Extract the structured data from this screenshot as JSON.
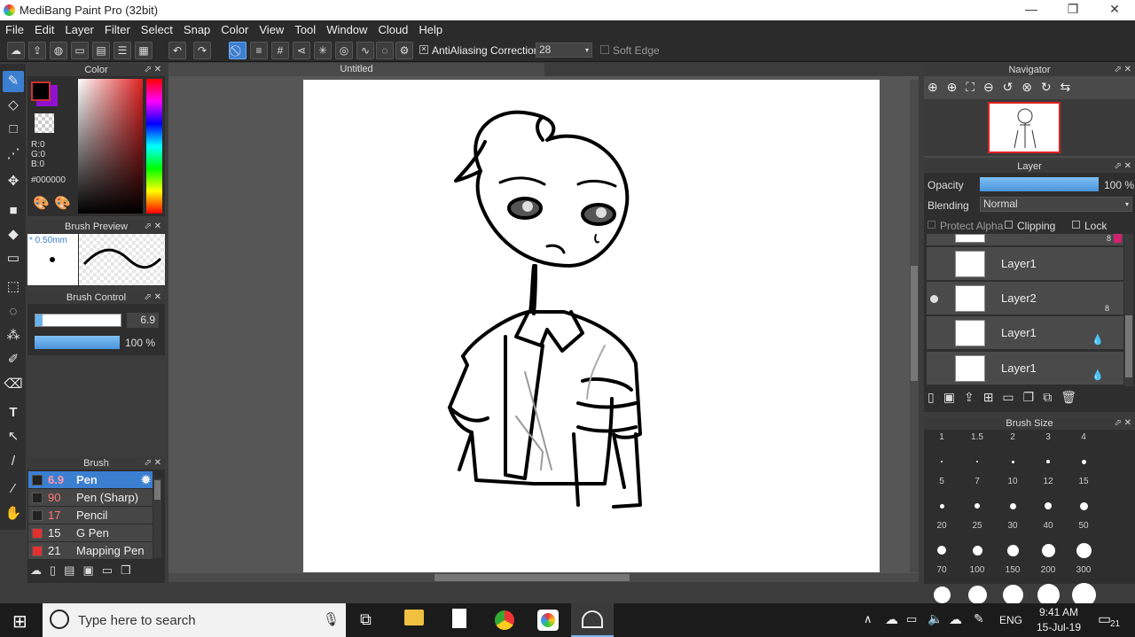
{
  "window": {
    "title": "MediBang Paint Pro (32bit)",
    "min": "—",
    "max": "❐",
    "close": "✕"
  },
  "menu": [
    "File",
    "Edit",
    "Layer",
    "Filter",
    "Select",
    "Snap",
    "Color",
    "View",
    "Tool",
    "Window",
    "Cloud",
    "Help"
  ],
  "toolbar": {
    "antialias_label": "AntiAliasing",
    "correction_label": "Correction",
    "correction_value": "28",
    "softedge_label": "Soft Edge"
  },
  "color_panel": {
    "title": "Color",
    "r": "R:0",
    "g": "G:0",
    "b": "B:0",
    "hex": "#000000"
  },
  "brush_preview": {
    "title": "Brush Preview",
    "size": "* 0.50mm"
  },
  "brush_control": {
    "title": "Brush Control",
    "size_value": "6.9",
    "opacity_value": "100 %",
    "size_fraction": 0.08,
    "opacity_fraction": 1.0
  },
  "brush_panel": {
    "title": "Brush",
    "items": [
      {
        "size": "6.9",
        "name": "Pen",
        "color": "#222222",
        "selected": true
      },
      {
        "size": "90",
        "name": "Pen (Sharp)",
        "color": "#222222"
      },
      {
        "size": "17",
        "name": "Pencil",
        "color": "#222222"
      },
      {
        "size": "15",
        "name": "G Pen",
        "color": "#e03030"
      },
      {
        "size": "21",
        "name": "Mapping Pen",
        "color": "#e03030"
      }
    ]
  },
  "document": {
    "tab": "Untitled"
  },
  "navigator": {
    "title": "Navigator"
  },
  "layer_panel": {
    "title": "Layer",
    "opacity_label": "Opacity",
    "opacity_value": "100 %",
    "opacity_fraction": 1.0,
    "blending_label": "Blending",
    "blending_value": "Normal",
    "protect_alpha": "Protect Alpha",
    "clipping": "Clipping",
    "lock": "Lock",
    "top_badge": "8",
    "layers": [
      {
        "name": "Layer1",
        "badge": ""
      },
      {
        "name": "Layer2",
        "badge": "8"
      },
      {
        "name": "Layer1",
        "badge": ""
      },
      {
        "name": "Layer1",
        "badge": ""
      }
    ]
  },
  "brush_size": {
    "title": "Brush Size",
    "sizes": [
      "1",
      "1.5",
      "2",
      "3",
      "4",
      "5",
      "7",
      "10",
      "12",
      "15",
      "20",
      "25",
      "30",
      "40",
      "50",
      "70",
      "100",
      "150",
      "200",
      "300"
    ]
  },
  "taskbar": {
    "search_placeholder": "Type here to search",
    "lang": "ENG",
    "time": "9:41 AM",
    "date": "15-Jul-19",
    "notif": "21"
  }
}
